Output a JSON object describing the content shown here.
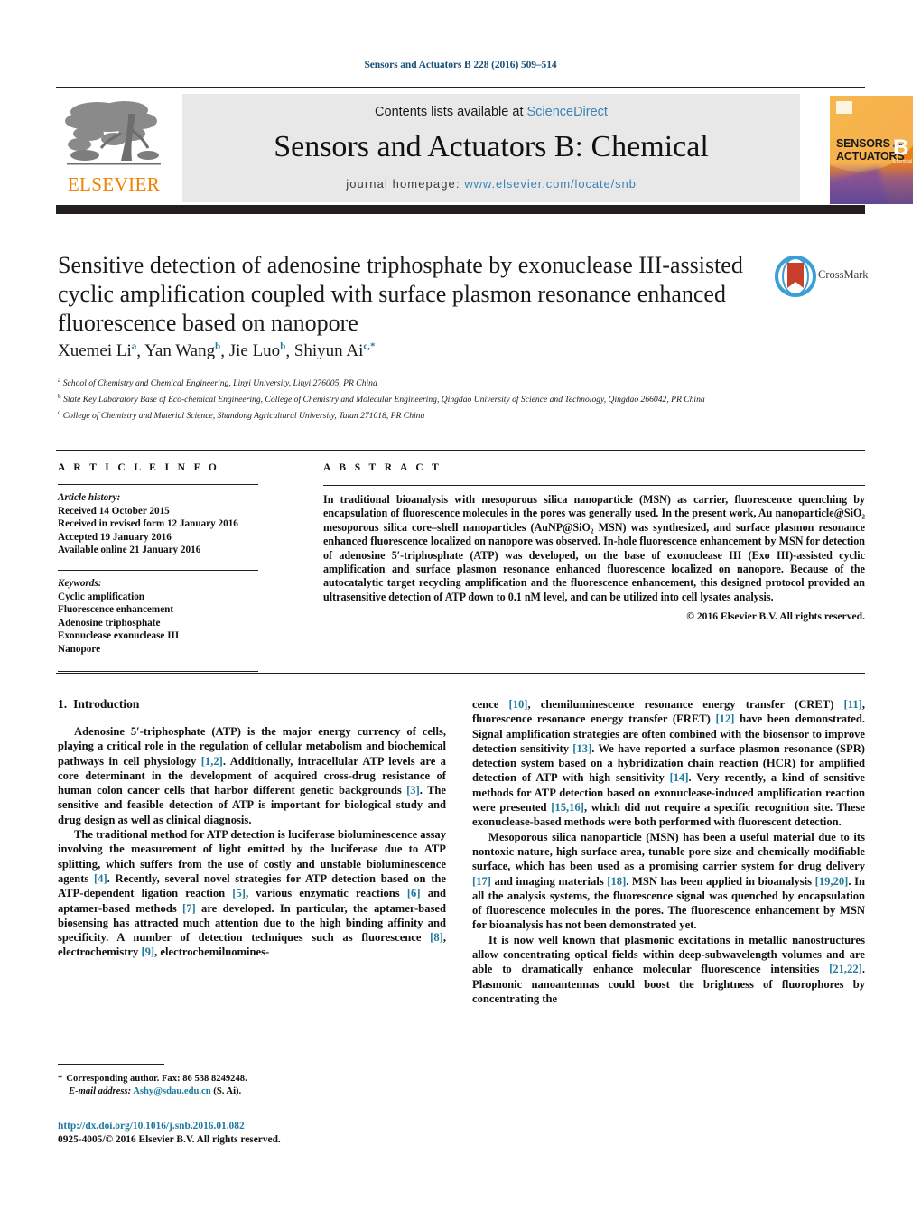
{
  "running_head": "Sensors and Actuators B 228 (2016) 509–514",
  "masthead": {
    "contents_prefix": "Contents lists available at ",
    "contents_link": "ScienceDirect",
    "journal_title": "Sensors and Actuators B: Chemical",
    "homepage_label": "journal homepage:",
    "homepage_url": "www.elsevier.com/locate/snb",
    "publisher_wordmark": "ELSEVIER",
    "cover": {
      "line1": "SENSORS",
      "line1_suffix": "and",
      "line2": "ACTUATORS",
      "volume_letter": "B",
      "volume_sub": "Chemical"
    }
  },
  "article": {
    "title": "Sensitive detection of adenosine triphosphate by exonuclease III-assisted cyclic amplification coupled with surface plasmon resonance enhanced fluorescence based on nanopore",
    "crossmark_label": "CrossMark",
    "authors": [
      {
        "name": "Xuemei Li",
        "marks": "a"
      },
      {
        "name": "Yan Wang",
        "marks": "b"
      },
      {
        "name": "Jie Luo",
        "marks": "b"
      },
      {
        "name": "Shiyun Ai",
        "marks": "c,*"
      }
    ],
    "affiliations": [
      {
        "mark": "a",
        "text": "School of Chemistry and Chemical Engineering, Linyi University, Linyi 276005, PR China"
      },
      {
        "mark": "b",
        "text": "State Key Laboratory Base of Eco-chemical Engineering, College of Chemistry and Molecular Engineering, Qingdao University of Science and Technology, Qingdao 266042, PR China"
      },
      {
        "mark": "c",
        "text": "College of Chemistry and Material Science, Shandong Agricultural University, Taian 271018, PR China"
      }
    ]
  },
  "article_info": {
    "heading": "A R T I C L E    I N F O",
    "history_title": "Article history:",
    "history": [
      "Received 14 October 2015",
      "Received in revised form 12 January 2016",
      "Accepted 19 January 2016",
      "Available online 21 January 2016"
    ],
    "keywords_title": "Keywords:",
    "keywords": [
      "Cyclic amplification",
      "Fluorescence enhancement",
      "Adenosine triphosphate",
      "Exonuclease exonuclease III",
      "Nanopore"
    ]
  },
  "abstract": {
    "heading": "A B S T R A C T",
    "text": "In traditional bioanalysis with mesoporous silica nanoparticle (MSN) as carrier, fluorescence quenching by encapsulation of fluorescence molecules in the pores was generally used. In the present work, Au nanoparticle@SiO₂ mesoporous silica core–shell nanoparticles (AuNP@SiO₂ MSN) was synthesized, and surface plasmon resonance enhanced fluorescence localized on nanopore was observed. In-hole fluorescence enhancement by MSN for detection of adenosine 5′-triphosphate (ATP) was developed, on the base of exonuclease III (Exo III)-assisted cyclic amplification and surface plasmon resonance enhanced fluorescence localized on nanopore. Because of the autocatalytic target recycling amplification and the fluorescence enhancement, this designed protocol provided an ultrasensitive detection of ATP down to 0.1 nM level, and can be utilized into cell lysates analysis.",
    "copyright": "© 2016 Elsevier B.V. All rights reserved."
  },
  "body": {
    "section_number": "1.",
    "section_title": "Introduction",
    "left_paragraphs": [
      "Adenosine 5′-triphosphate (ATP) is the major energy currency of cells, playing a critical role in the regulation of cellular metabolism and biochemical pathways in cell physiology [1,2]. Additionally, intracellular ATP levels are a core determinant in the development of acquired cross-drug resistance of human colon cancer cells that harbor different genetic backgrounds [3]. The sensitive and feasible detection of ATP is important for biological study and drug design as well as clinical diagnosis.",
      "The traditional method for ATP detection is luciferase bioluminescence assay involving the measurement of light emitted by the luciferase due to ATP splitting, which suffers from the use of costly and unstable bioluminescence agents [4]. Recently, several novel strategies for ATP detection based on the ATP-dependent ligation reaction [5], various enzymatic reactions [6] and aptamer-based methods [7] are developed. In particular, the aptamer-based biosensing has attracted much attention due to the high binding affinity and specificity. A number of detection techniques such as fluorescence [8], electrochemistry [9], electrochemiluomines-"
    ],
    "right_paragraphs": [
      "cence [10], chemiluminescence resonance energy transfer (CRET) [11], fluorescence resonance energy transfer (FRET) [12] have been demonstrated. Signal amplification strategies are often combined with the biosensor to improve detection sensitivity [13]. We have reported a surface plasmon resonance (SPR) detection system based on a hybridization chain reaction (HCR) for amplified detection of ATP with high sensitivity [14]. Very recently, a kind of sensitive methods for ATP detection based on exonuclease-induced amplification reaction were presented [15,16], which did not require a specific recognition site. These exonuclease-based methods were both performed with fluorescent detection.",
      "Mesoporous silica nanoparticle (MSN) has been a useful material due to its nontoxic nature, high surface area, tunable pore size and chemically modifiable surface, which has been used as a promising carrier system for drug delivery [17] and imaging materials [18]. MSN has been applied in bioanalysis [19,20]. In all the analysis systems, the fluorescence signal was quenched by encapsulation of fluorescence molecules in the pores. The fluorescence enhancement by MSN for bioanalysis has not been demonstrated yet.",
      "It is now well known that plasmonic excitations in metallic nanostructures allow concentrating optical fields within deep-subwavelength volumes and are able to dramatically enhance molecular fluorescence intensities [21,22]. Plasmonic nanoantennas could boost the brightness of fluorophores by concentrating the"
    ]
  },
  "footnotes": {
    "corresponding_marker": "*",
    "corresponding_text": "Corresponding author. Fax: 86 538 8249248.",
    "email_label": "E-mail address:",
    "email": "Ashy@sdau.edu.cn",
    "email_owner": "(S. Ai)."
  },
  "footer": {
    "doi": "http://dx.doi.org/10.1016/j.snb.2016.01.082",
    "issn_line": "0925-4005/© 2016 Elsevier B.V. All rights reserved."
  },
  "colors": {
    "link_blue": "#1f7a9e",
    "sd_blue": "#3a82b5",
    "elsevier_orange": "#f08000",
    "rule_black": "#231f20",
    "band_grey": "#e8e8e8"
  }
}
